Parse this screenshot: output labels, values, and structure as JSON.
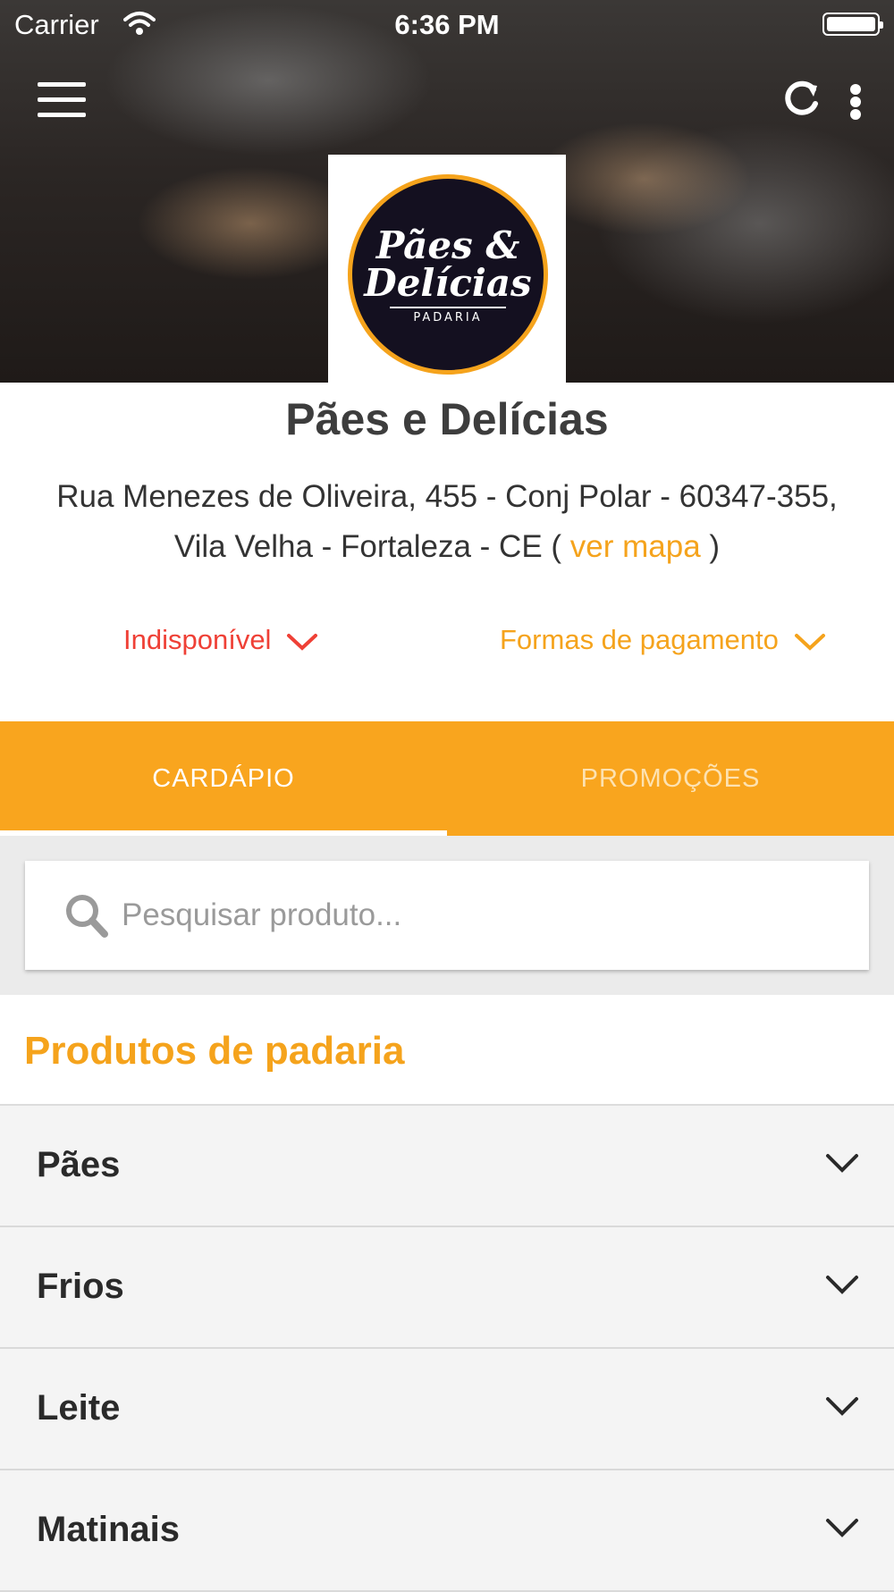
{
  "status_bar": {
    "carrier": "Carrier",
    "time": "6:36 PM"
  },
  "store": {
    "name": "Pães e Delícias",
    "address_line1": "Rua Menezes de Oliveira, 455 - Conj Polar - 60347-355,",
    "address_line2": "Vila Velha - Fortaleza - CE ( ",
    "map_link": "ver mapa",
    "address_close": " )",
    "logo": {
      "line1": "Pães &",
      "line2": "Delícias",
      "line3": "PADARIA"
    }
  },
  "availability": {
    "label": "Indisponível",
    "color": "#ef4036"
  },
  "payment": {
    "label": "Formas de pagamento",
    "color": "#f5a31c"
  },
  "tabs": [
    {
      "label": "CARDÁPIO",
      "active": true
    },
    {
      "label": "PROMOÇÕES",
      "active": false
    }
  ],
  "search": {
    "placeholder": "Pesquisar produto...",
    "value": ""
  },
  "section": {
    "title": "Produtos de padaria"
  },
  "categories": [
    {
      "label": "Pães"
    },
    {
      "label": "Frios"
    },
    {
      "label": "Leite"
    },
    {
      "label": "Matinais"
    }
  ],
  "colors": {
    "accent": "#f9a51e",
    "error": "#ef4036"
  },
  "icons": [
    "wifi-icon",
    "battery-icon",
    "menu-icon",
    "refresh-icon",
    "more-vertical-icon",
    "chevron-down-icon",
    "search-icon"
  ]
}
